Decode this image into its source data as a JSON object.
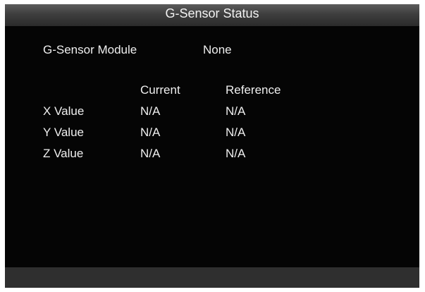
{
  "window": {
    "title": "G-Sensor Status"
  },
  "module": {
    "label": "G-Sensor Module",
    "value": "None"
  },
  "table": {
    "headers": {
      "current": "Current",
      "reference": "Reference"
    },
    "rows": [
      {
        "label": "X Value",
        "current": "N/A",
        "reference": "N/A"
      },
      {
        "label": "Y Value",
        "current": "N/A",
        "reference": "N/A"
      },
      {
        "label": "Z Value",
        "current": "N/A",
        "reference": "N/A"
      }
    ]
  }
}
